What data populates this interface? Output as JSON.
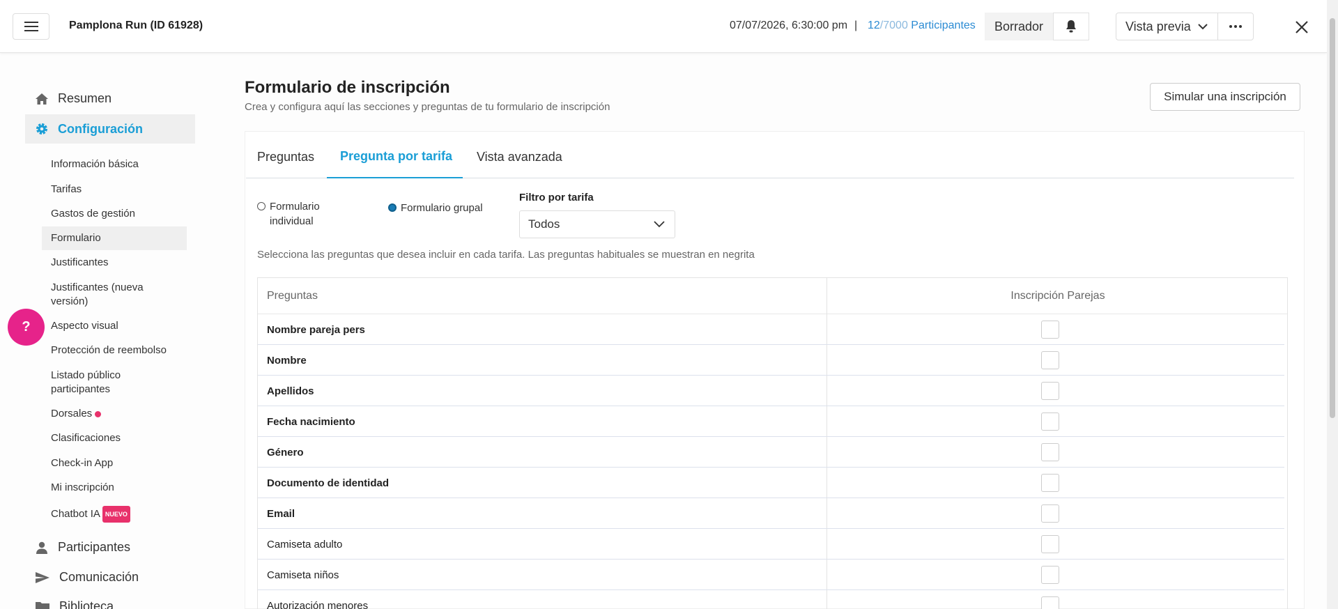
{
  "header": {
    "event_title": "Pamplona Run (ID 61928)",
    "date": "07/07/2026, 6:30:00 pm",
    "separator": "|",
    "participants_current": "12",
    "participants_total": "/7000",
    "participants_label": "Participantes",
    "status": "Borrador",
    "preview_label": "Vista previa"
  },
  "sidebar": {
    "resumen": "Resumen",
    "configuracion": "Configuración",
    "sub_items": [
      "Información básica",
      "Tarifas",
      "Gastos de gestión",
      "Formulario",
      "Justificantes",
      "Justificantes (nueva versión)",
      "Aspecto visual",
      "Protección de reembolso",
      "Listado público participantes",
      "Dorsales",
      "Clasificaciones",
      "Check-in App",
      "Mi inscripción",
      "Chatbot IA"
    ],
    "new_badge": "NUEVO",
    "participantes": "Participantes",
    "comunicacion": "Comunicación",
    "biblioteca": "Biblioteca",
    "help": "?"
  },
  "main": {
    "title": "Formulario de inscripción",
    "subtitle": "Crea y configura aquí las secciones y preguntas de tu formulario de inscripción",
    "simulate_button": "Simular una inscripción",
    "tabs": [
      "Preguntas",
      "Pregunta por tarifa",
      "Vista avanzada"
    ],
    "radio_individual": "Formulario individual",
    "radio_group": "Formulario grupal",
    "filter_label": "Filtro por tarifa",
    "filter_value": "Todos",
    "helper_text": "Selecciona las preguntas que desea incluir en cada tarifa. Las preguntas habituales se muestran en negrita",
    "table": {
      "col_questions": "Preguntas",
      "col_rate": "Inscripción Parejas",
      "rows": [
        {
          "label": "Nombre pareja pers",
          "bold": true
        },
        {
          "label": "Nombre",
          "bold": true
        },
        {
          "label": "Apellidos",
          "bold": true
        },
        {
          "label": "Fecha nacimiento",
          "bold": true
        },
        {
          "label": "Género",
          "bold": true
        },
        {
          "label": "Documento de identidad",
          "bold": true
        },
        {
          "label": "Email",
          "bold": true
        },
        {
          "label": "Camiseta adulto",
          "bold": false
        },
        {
          "label": "Camiseta niños",
          "bold": false
        },
        {
          "label": "Autorización menores",
          "bold": false
        }
      ]
    }
  },
  "colors": {
    "accent": "#1a9ed6",
    "badge": "#e8316b",
    "help": "#e6238a"
  }
}
